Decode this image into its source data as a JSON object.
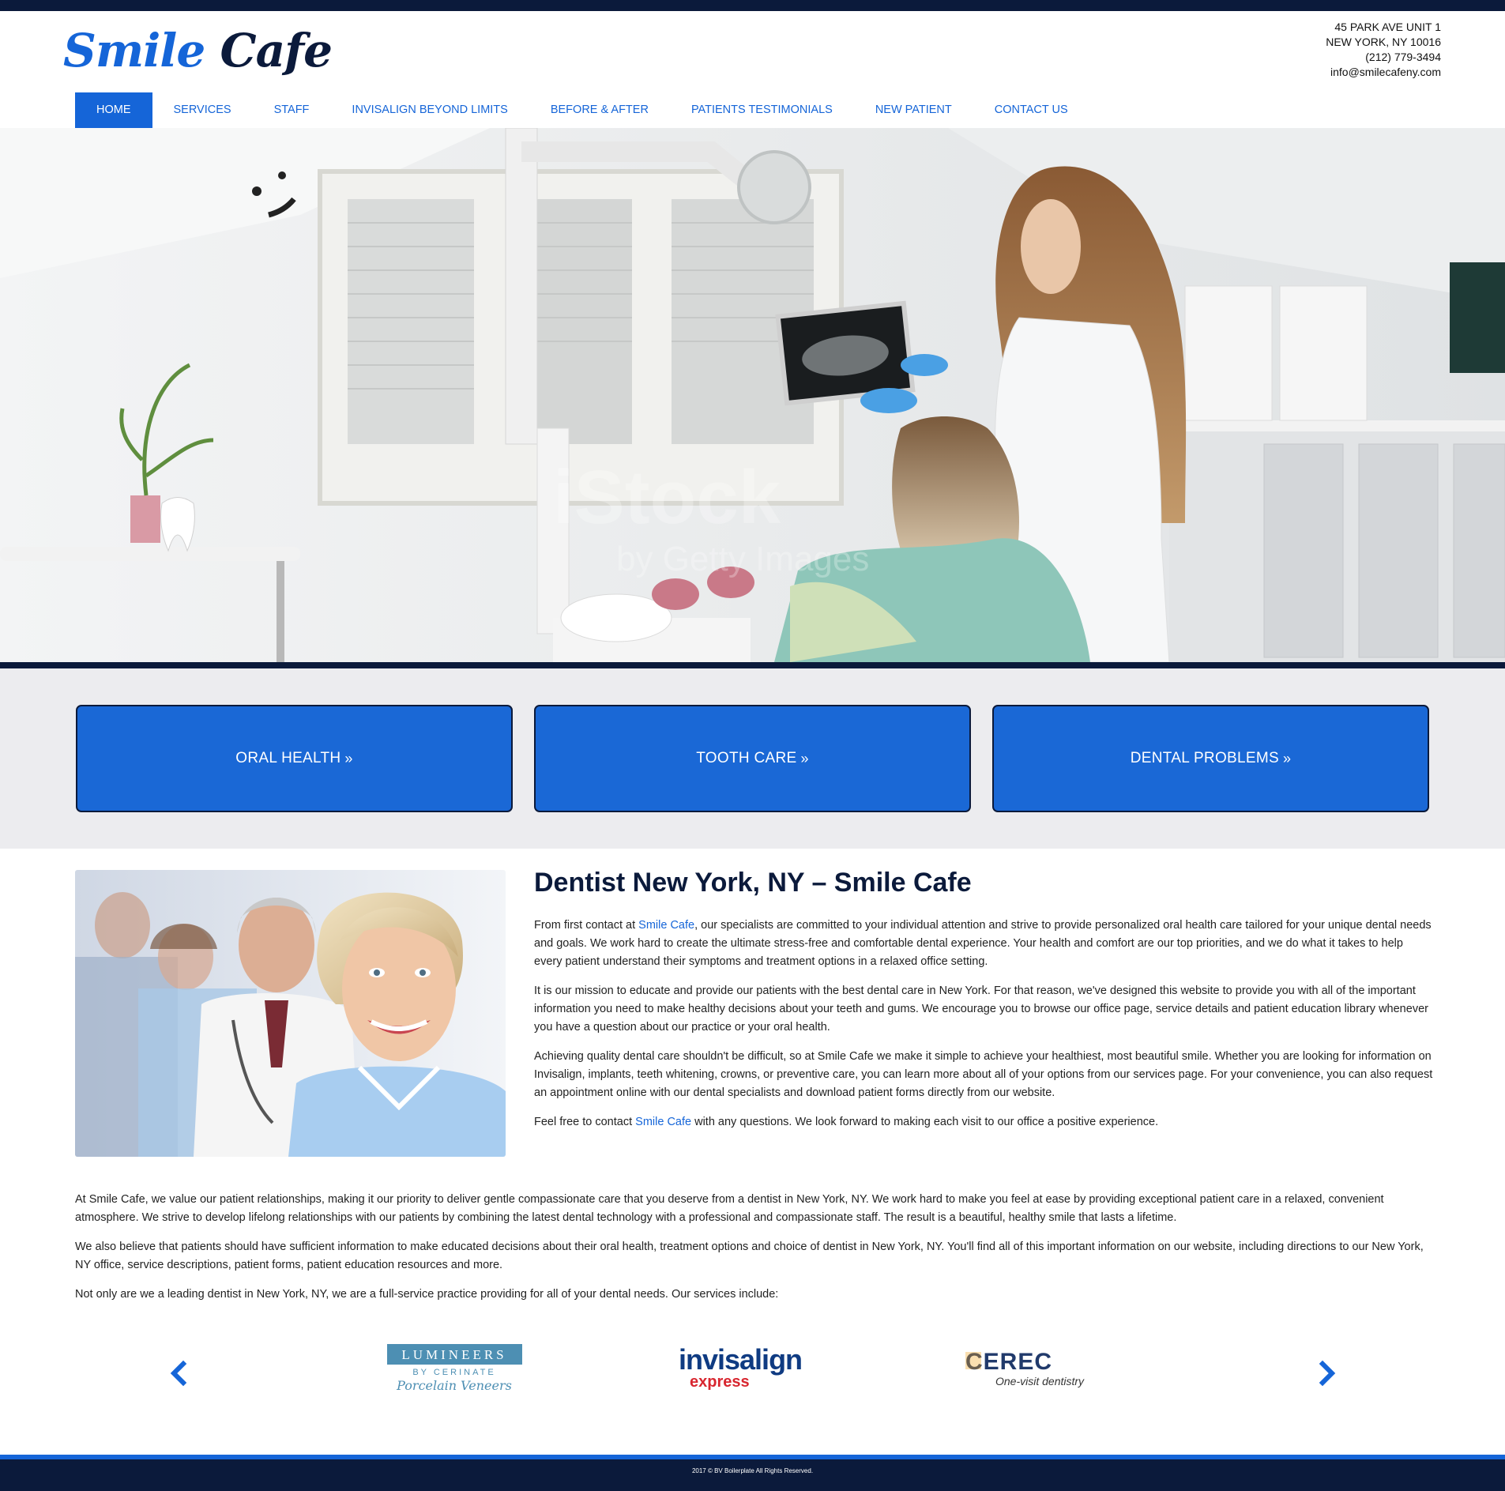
{
  "brand": {
    "word1": "Smile",
    "word2": "Cafe"
  },
  "contact": {
    "address1": "45 PARK AVE UNIT 1",
    "address2": "NEW YORK, NY 10016",
    "phone": "(212) 779-3494",
    "email": "info@smilecafeny.com"
  },
  "nav": [
    {
      "label": "HOME",
      "active": true
    },
    {
      "label": "SERVICES"
    },
    {
      "label": "STAFF"
    },
    {
      "label": "INVISALIGN BEYOND LIMITS"
    },
    {
      "label": "BEFORE & AFTER"
    },
    {
      "label": "PATIENTS TESTIMONIALS"
    },
    {
      "label": "NEW PATIENT"
    },
    {
      "label": "CONTACT US"
    }
  ],
  "hero": {
    "watermark": "iStock",
    "watermark_sub": "by Getty Images"
  },
  "cta": [
    {
      "label": "ORAL HEALTH",
      "chevron": "»"
    },
    {
      "label": "TOOTH CARE",
      "chevron": "»"
    },
    {
      "label": "DENTAL PROBLEMS",
      "chevron": "»"
    }
  ],
  "main": {
    "title": "Dentist New York, NY – Smile Cafe",
    "p1_a": "From first contact at ",
    "p1_link": "Smile Cafe",
    "p1_b": ", our specialists are committed to your individual attention and strive to provide personalized oral health care tailored for your unique dental needs and goals. We work hard to create the ultimate stress-free and comfortable dental experience. Your health and comfort are our top priorities, and we do what it takes to help every patient understand their symptoms and treatment options in a relaxed office setting.",
    "p2": "It is our mission to educate and provide our patients with the best dental care in New York. For that reason, we've designed this website to provide you with all of the important information you need to make healthy decisions about your teeth and gums. We encourage you to browse our office page, service details and patient education library whenever you have a question about our practice or your oral health.",
    "p3": "Achieving quality dental care shouldn't be difficult, so at Smile Cafe we make it simple to achieve your healthiest, most beautiful smile. Whether you are looking for information on Invisalign, implants, teeth whitening, crowns, or preventive care, you can learn more about all of your options from our services page. For your convenience, you can also request an appointment online with our dental specialists and download patient forms directly from our website.",
    "p4_a": "Feel free to contact ",
    "p4_link": "Smile Cafe",
    "p4_b": " with any questions. We look forward to making each visit to our office a positive experience."
  },
  "body": {
    "p1": "At Smile Cafe, we value our patient relationships, making it our priority to deliver gentle compassionate care that you deserve from a dentist in New York, NY. We work hard to make you feel at ease by providing exceptional patient care in a relaxed, convenient atmosphere. We strive to develop lifelong relationships with our patients by combining the latest dental technology with a professional and compassionate staff. The result is a beautiful, healthy smile that lasts a lifetime.",
    "p2": "We also believe that patients should have sufficient information to make educated decisions about their oral health, treatment options and choice of dentist in New York, NY. You'll find all of this important information on our website, including directions to our New York, NY office, service descriptions, patient forms, patient education resources and more.",
    "p3": "Not only are we a leading dentist in New York, NY, we are a full-service practice providing for all of your dental needs. Our services include:"
  },
  "brands": {
    "lumineers_top": "LUMINEERS",
    "lumineers_mid": "BY CERINATE",
    "lumineers_sub": "Porcelain Veneers",
    "invisalign": "invisalign",
    "invisalign_sub": "express",
    "cerec": "CEREC",
    "cerec_sub": "One-visit dentistry"
  },
  "footer": {
    "text": "2017 © BV Boilerplate All Rights Reserved."
  },
  "colors": {
    "primary": "#1565d8",
    "navy": "#0b1a3b",
    "band": "#ececef"
  }
}
